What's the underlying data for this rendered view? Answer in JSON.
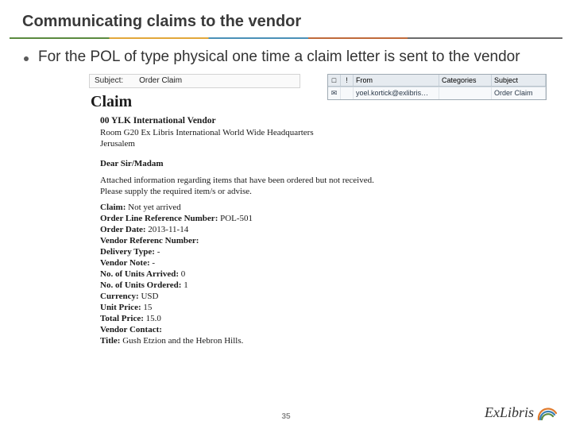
{
  "slide": {
    "title": "Communicating claims to the vendor",
    "bullet": "For the POL of type physical one time a claim letter is sent to the vendor",
    "page_number": "35"
  },
  "inbox": {
    "headers": {
      "icon": "",
      "attach": "",
      "from": "From",
      "categories": "Categories",
      "subject": "Subject"
    },
    "row": {
      "from": "yoel.kortick@exlibris…",
      "categories": "",
      "subject": "Order Claim"
    }
  },
  "subject": {
    "label": "Subject:",
    "value": "Order Claim"
  },
  "letter": {
    "heading": "Claim",
    "vendor": "00 YLK International Vendor",
    "address1": "Room G20 Ex Libris International World Wide Headquarters",
    "address2": "Jerusalem",
    "greeting": "Dear Sir/Madam",
    "body1": "Attached information regarding items that have been ordered but not received.",
    "body2": "Please supply the required item/s or advise.",
    "fields": {
      "claim": {
        "label": "Claim:",
        "value": "Not yet arrived"
      },
      "orderline": {
        "label": "Order Line Reference Number:",
        "value": "POL-501"
      },
      "orderdate": {
        "label": "Order Date:",
        "value": "2013-11-14"
      },
      "vendorref": {
        "label": "Vendor Referenc Number:",
        "value": ""
      },
      "deliverytype": {
        "label": "Delivery Type:",
        "value": "-"
      },
      "vendornote": {
        "label": "Vendor Note:",
        "value": "-"
      },
      "unitsarrived": {
        "label": "No. of Units Arrived:",
        "value": "0"
      },
      "unitsordered": {
        "label": "No. of Units Ordered:",
        "value": "1"
      },
      "currency": {
        "label": "Currency:",
        "value": "USD"
      },
      "unitprice": {
        "label": "Unit Price:",
        "value": "15"
      },
      "totalprice": {
        "label": "Total Price:",
        "value": "15.0"
      },
      "vendorcontact": {
        "label": "Vendor Contact:",
        "value": ""
      },
      "title": {
        "label": "Title:",
        "value": "Gush Etzion and the Hebron Hills."
      }
    }
  },
  "logo": {
    "text": "ExLibris"
  }
}
